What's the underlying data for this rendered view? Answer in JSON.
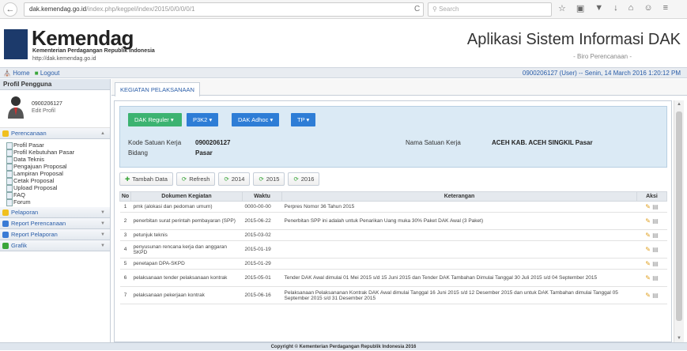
{
  "browser": {
    "url_host": "dak.kemendag.go.id",
    "url_path": "/index.php/kegpel/index/2015/0/0/0/0/1",
    "search_placeholder": "Search"
  },
  "header": {
    "brand": "Kemendag",
    "subtitle": "Kementerian Perdagangan Republik Indonesia",
    "url": "http://dak.kemendag.go.id",
    "app_title": "Aplikasi Sistem Informasi DAK",
    "app_sub": "- Biro Perencanaan -"
  },
  "topbar": {
    "home": "Home",
    "logout": "Logout",
    "user_info": "0900206127 (User) -- Senin, 14 March 2016 1:20:12 PM"
  },
  "sidebar": {
    "profile_heading": "Profil Pengguna",
    "user_id": "0900206127",
    "edit_profile": "Edit Profil",
    "perencanaan": "Perencanaan",
    "items": [
      "Profil Pasar",
      "Profil Kebutuhan Pasar",
      "Data Teknis",
      "Pengajuan Proposal",
      "Lampiran Proposal",
      "Cetak Proposal",
      "Upload Proposal",
      "FAQ",
      "Forum"
    ],
    "pelaporan": "Pelaporan",
    "report_perencanaan": "Report Perencanaan",
    "report_pelaporan": "Report Pelaporan",
    "grafik": "Grafik"
  },
  "main": {
    "tab": "KEGIATAN PELAKSANAAN",
    "buttons": {
      "dak_reguler": "DAK Reguler",
      "p3k2": "P3K2",
      "dak_adhoc": "DAK Adhoc",
      "tp": "TP"
    },
    "kode_label": "Kode Satuan Kerja",
    "kode_val": "0900206127",
    "bidang_label": "Bidang",
    "bidang_val": "Pasar",
    "nama_label": "Nama Satuan Kerja",
    "nama_val": "ACEH KAB. ACEH SINGKIL Pasar",
    "toolbar": {
      "tambah": "Tambah Data",
      "refresh": "Refresh",
      "y2014": "2014",
      "y2015": "2015",
      "y2016": "2016"
    },
    "columns": {
      "no": "No",
      "doc": "Dokumen Kegiatan",
      "waktu": "Waktu",
      "ket": "Keterangan",
      "aksi": "Aksi"
    },
    "rows": [
      {
        "no": "1",
        "doc": "pmk (alokasi dan pedoman umum)",
        "waktu": "0000-00-00",
        "ket": "Perpres Nomor 36 Tahun 2015"
      },
      {
        "no": "2",
        "doc": "penerbitan surat perintah pembayaran (SPP)",
        "waktu": "2015-06-22",
        "ket": "Penerbitan SPP ini adalah untuk Penarikan Uang muka 30% Paket DAK Awal (3 Paket)"
      },
      {
        "no": "3",
        "doc": "petunjuk teknis",
        "waktu": "2015-03-02",
        "ket": ""
      },
      {
        "no": "4",
        "doc": "penyusunan rencana kerja dan anggaran SKPD",
        "waktu": "2015-01-19",
        "ket": ""
      },
      {
        "no": "5",
        "doc": "penetapan DPA-SKPD",
        "waktu": "2015-01-29",
        "ket": ""
      },
      {
        "no": "6",
        "doc": "pelaksanaan tender pelaksanaan kontrak",
        "waktu": "2015-05-01",
        "ket": "Tender DAK Awal dimulai 01 Mei 2015 s/d 15 Juni 2015 dan Tender DAK Tambahan Dimulai Tanggal 30 Juli 2015 s/d 04 September 2015"
      },
      {
        "no": "7",
        "doc": "pelaksanaan pekerjaan kontrak",
        "waktu": "2015-06-16",
        "ket": "Pelaksanaan Pelaksananan Kontrak DAK Awal dimulai Tanggal 16 Juni 2015 s/d 12 Desember 2015 dan untuk DAK Tambahan dimulai Tanggal 05 September 2015 s/d 31 Desember 2015"
      }
    ]
  },
  "footer": "Copyright © Kementerian Perdagangan Republik Indonesia 2016",
  "colors": {
    "dak_reguler": "#3cb371",
    "p3k2": "#2e7dd6",
    "dak_adhoc": "#2e7dd6",
    "tp": "#2e7dd6"
  }
}
